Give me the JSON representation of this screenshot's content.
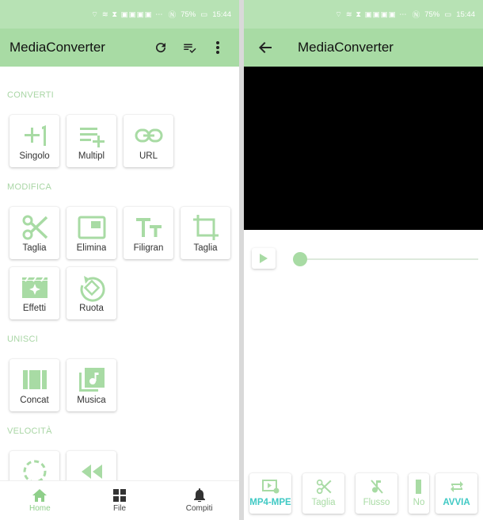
{
  "colors": {
    "appbar": "#a8dba4",
    "accent_green": "#a8dba4",
    "accent_teal": "#3fc9c4"
  },
  "status": {
    "battery": "75%",
    "time": "15:44"
  },
  "left": {
    "app_title": "MediaConverter",
    "sections": {
      "converti": "CONVERTI",
      "modifica": "MODIFICA",
      "unisci": "UNISCI",
      "velocita": "VELOCITÀ"
    },
    "converti_items": [
      {
        "label": "Singolo",
        "icon": "plus-one-icon"
      },
      {
        "label": "Multipl",
        "icon": "playlist-add-icon"
      },
      {
        "label": "URL",
        "icon": "link-icon"
      }
    ],
    "modifica_items": [
      {
        "label": "Taglia",
        "icon": "scissors-icon"
      },
      {
        "label": "Elimina",
        "icon": "picture-in-picture-icon"
      },
      {
        "label": "Filigran",
        "icon": "text-size-icon"
      },
      {
        "label": "Taglia",
        "icon": "crop-icon"
      },
      {
        "label": "Effetti",
        "icon": "movie-effects-icon"
      },
      {
        "label": "Ruota",
        "icon": "rotate-icon"
      }
    ],
    "unisci_items": [
      {
        "label": "Concat",
        "icon": "film-strip-icon"
      },
      {
        "label": "Musica",
        "icon": "music-library-icon"
      }
    ],
    "nav": [
      {
        "label": "Home",
        "icon": "home-icon",
        "active": true
      },
      {
        "label": "File",
        "icon": "grid-icon",
        "active": false
      },
      {
        "label": "Compiti",
        "icon": "bell-icon",
        "active": false
      }
    ]
  },
  "right": {
    "app_title": "MediaConverter",
    "footer": [
      {
        "label": "MP4-MPE",
        "icon": "video-settings-icon",
        "accent": true
      },
      {
        "label": "Taglia",
        "icon": "scissors-icon",
        "accent": false
      },
      {
        "label": "Flusso",
        "icon": "audio-off-icon",
        "accent": false
      },
      {
        "label": "No",
        "icon": "bar-icon",
        "accent": false
      },
      {
        "label": "AVVIA",
        "icon": "repeat-icon",
        "accent": true
      }
    ]
  }
}
